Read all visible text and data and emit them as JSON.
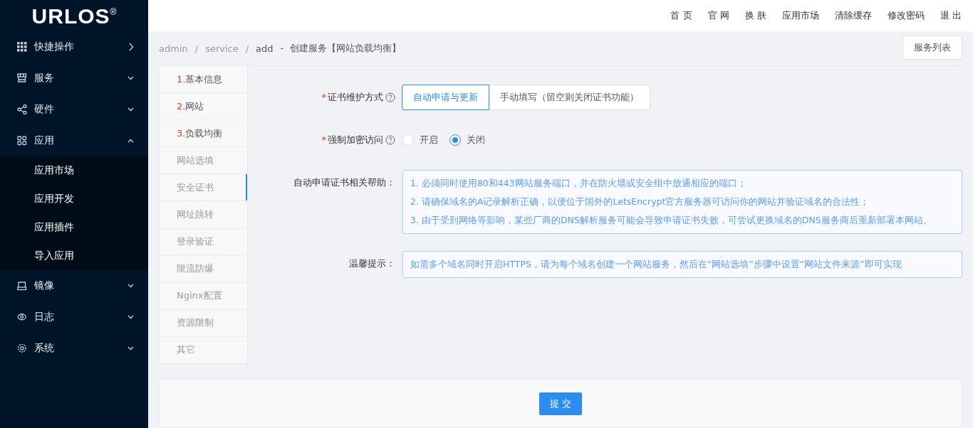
{
  "sidebar": {
    "logo": "URLOS",
    "logo_mark": "®",
    "items": [
      {
        "label": "快捷操作",
        "kind": "flyout"
      },
      {
        "label": "服务",
        "kind": "submenu",
        "expanded": false
      },
      {
        "label": "硬件",
        "kind": "submenu",
        "expanded": false
      },
      {
        "label": "应用",
        "kind": "submenu",
        "expanded": true,
        "children": [
          {
            "label": "应用市场"
          },
          {
            "label": "应用开发"
          },
          {
            "label": "应用插件"
          },
          {
            "label": "导入应用"
          }
        ]
      },
      {
        "label": "镜像",
        "kind": "submenu",
        "expanded": false
      },
      {
        "label": "日志",
        "kind": "submenu",
        "expanded": false
      },
      {
        "label": "系统",
        "kind": "submenu",
        "expanded": false
      }
    ]
  },
  "header": {
    "links": [
      "首 页",
      "官 网",
      "换 肤",
      "应用市场",
      "清除缓存",
      "修改密码",
      "退 出"
    ]
  },
  "breadcrumb": {
    "items": [
      "admin",
      "service",
      "add"
    ],
    "separator": "/",
    "title": "-  创建服务【网站负载均衡】"
  },
  "list_button": "服务列表",
  "steps": [
    {
      "number": "1.",
      "label": "基本信息",
      "completed": true,
      "selected": false
    },
    {
      "number": "2.",
      "label": "网站",
      "completed": true,
      "selected": false
    },
    {
      "number": "3.",
      "label": "负载均衡",
      "completed": true,
      "selected": false
    },
    {
      "label": "网站选填",
      "completed": false,
      "selected": false
    },
    {
      "label": "安全证书",
      "completed": false,
      "selected": true
    },
    {
      "label": "网址跳转",
      "completed": false,
      "selected": false
    },
    {
      "label": "登录验证",
      "completed": false,
      "selected": false
    },
    {
      "label": "限流防爆",
      "completed": false,
      "selected": false
    },
    {
      "label": "Nginx配置",
      "completed": false,
      "selected": false
    },
    {
      "label": "资源限制",
      "completed": false,
      "selected": false
    },
    {
      "label": "其它",
      "completed": false,
      "selected": false
    }
  ],
  "form": [
    {
      "kind": "segmented",
      "required_mark": "*",
      "label": "证书维护方式",
      "options": [
        {
          "label": "自动申请与更新",
          "selected": true
        },
        {
          "label": "手动填写（留空则关闭证书功能）",
          "selected": false
        }
      ]
    },
    {
      "kind": "radio",
      "required_mark": "*",
      "label": "强制加密访问",
      "options": [
        {
          "label": "开启",
          "selected": false
        },
        {
          "label": "关闭",
          "selected": true
        }
      ]
    },
    {
      "kind": "note",
      "label": "自动申请证书相关帮助：",
      "lines": [
        "1. 必须同时使用80和443网站服务端口，并在防火墙或安全组中放通相应的端口；",
        "2. 请确保域名的A记录解析正确，以便位于国外的LetsEncrypt官方服务器可访问你的网站并验证域名的合法性；",
        "3. 由于受到网络等影响，某些厂商的DNS解析服务可能会导致申请证书失败，可尝试更换域名的DNS服务商后重新部署本网站。"
      ]
    },
    {
      "kind": "note",
      "label": "温馨提示：",
      "lines": [
        "如需多个域名同时开启HTTPS，请为每个域名创建一个网站服务，然后在“网站选填”步骤中设置“网站文件来源”即可实现"
      ]
    }
  ],
  "submit": "提 交"
}
